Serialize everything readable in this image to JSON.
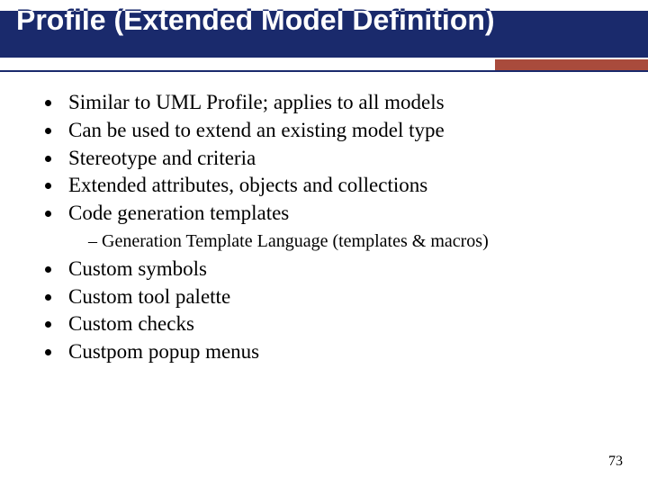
{
  "title": "Profile (Extended Model Definition)",
  "bullets_top": [
    "Similar to UML Profile; applies to all models",
    "Can be used to extend an existing model type",
    "Stereotype and criteria",
    "Extended attributes, objects and collections",
    "Code generation templates"
  ],
  "sub_bullet": "Generation Template Language (templates & macros)",
  "bullets_bottom": [
    "Custom symbols",
    "Custom tool palette",
    "Custom checks",
    "Custpom popup menus"
  ],
  "page_number": "73"
}
